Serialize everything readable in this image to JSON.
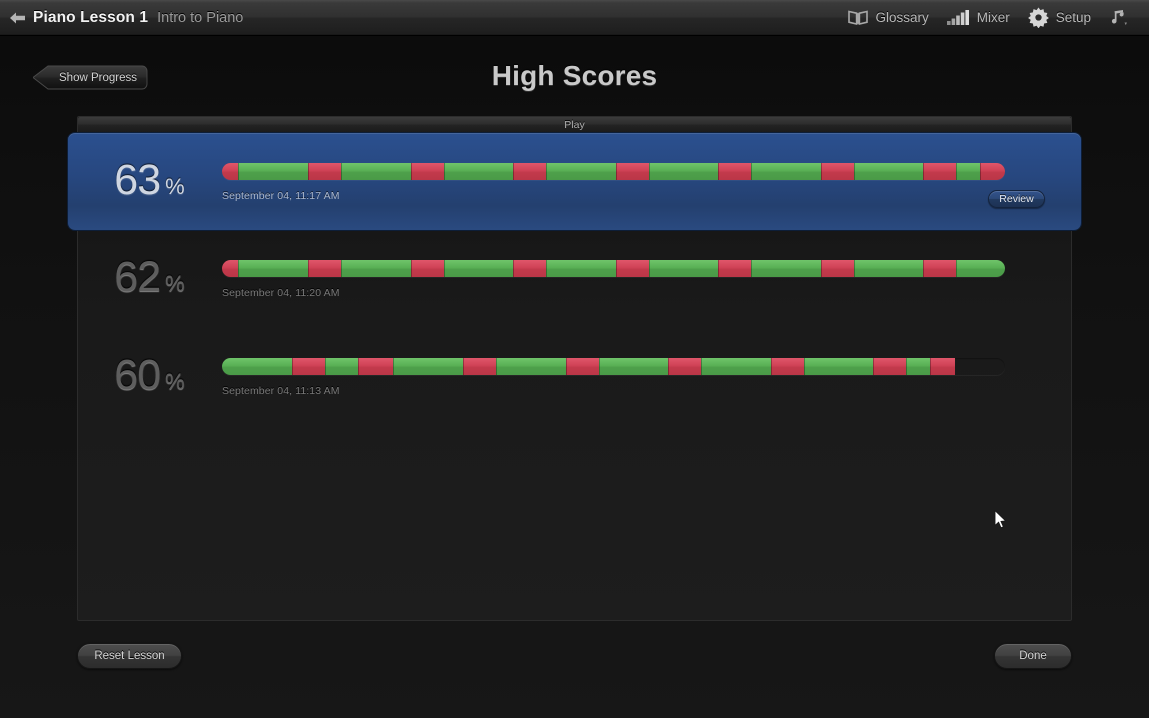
{
  "toolbar": {
    "back_icon": "back-arrow-icon",
    "title": "Piano Lesson 1",
    "subtitle": "Intro to Piano",
    "items": [
      {
        "icon": "book-icon",
        "label": "Glossary"
      },
      {
        "icon": "mixer-icon",
        "label": "Mixer"
      },
      {
        "icon": "gear-icon",
        "label": "Setup"
      },
      {
        "icon": "music-note-icon",
        "label": ""
      }
    ]
  },
  "header": {
    "show_progress_label": "Show Progress",
    "page_title": "High Scores"
  },
  "panel": {
    "section_label": "Play"
  },
  "scores": [
    {
      "percent": "63",
      "percent_sign": "%",
      "timestamp": "September 04, 11:17 AM",
      "selected": true,
      "review_label": "Review",
      "segments": [
        {
          "color": "r",
          "w": 2.1
        },
        {
          "color": "g",
          "w": 8.9
        },
        {
          "color": "r",
          "w": 4.2
        },
        {
          "color": "g",
          "w": 8.9
        },
        {
          "color": "r",
          "w": 4.2
        },
        {
          "color": "g",
          "w": 8.9
        },
        {
          "color": "r",
          "w": 4.2
        },
        {
          "color": "g",
          "w": 8.9
        },
        {
          "color": "r",
          "w": 4.2
        },
        {
          "color": "g",
          "w": 8.9
        },
        {
          "color": "r",
          "w": 4.2
        },
        {
          "color": "g",
          "w": 8.9
        },
        {
          "color": "r",
          "w": 4.2
        },
        {
          "color": "g",
          "w": 8.9
        },
        {
          "color": "r",
          "w": 4.2
        },
        {
          "color": "g",
          "w": 3.0
        },
        {
          "color": "r",
          "w": 3.2
        }
      ]
    },
    {
      "percent": "62",
      "percent_sign": "%",
      "timestamp": "September 04, 11:20 AM",
      "selected": false,
      "review_label": "",
      "segments": [
        {
          "color": "r",
          "w": 2.1
        },
        {
          "color": "g",
          "w": 8.9
        },
        {
          "color": "r",
          "w": 4.2
        },
        {
          "color": "g",
          "w": 8.9
        },
        {
          "color": "r",
          "w": 4.2
        },
        {
          "color": "g",
          "w": 8.9
        },
        {
          "color": "r",
          "w": 4.2
        },
        {
          "color": "g",
          "w": 8.9
        },
        {
          "color": "r",
          "w": 4.2
        },
        {
          "color": "g",
          "w": 8.9
        },
        {
          "color": "r",
          "w": 4.2
        },
        {
          "color": "g",
          "w": 8.9
        },
        {
          "color": "r",
          "w": 4.2
        },
        {
          "color": "g",
          "w": 8.9
        },
        {
          "color": "r",
          "w": 4.2
        },
        {
          "color": "g",
          "w": 6.2
        }
      ]
    },
    {
      "percent": "60",
      "percent_sign": "%",
      "timestamp": "September 04, 11:13 AM",
      "selected": false,
      "review_label": "",
      "segments": [
        {
          "color": "g",
          "w": 8.9
        },
        {
          "color": "r",
          "w": 4.2
        },
        {
          "color": "g",
          "w": 4.3
        },
        {
          "color": "r",
          "w": 4.5
        },
        {
          "color": "g",
          "w": 8.9
        },
        {
          "color": "r",
          "w": 4.2
        },
        {
          "color": "g",
          "w": 8.9
        },
        {
          "color": "r",
          "w": 4.2
        },
        {
          "color": "g",
          "w": 8.9
        },
        {
          "color": "r",
          "w": 4.2
        },
        {
          "color": "g",
          "w": 8.9
        },
        {
          "color": "r",
          "w": 4.2
        },
        {
          "color": "g",
          "w": 8.9
        },
        {
          "color": "r",
          "w": 4.2
        },
        {
          "color": "g",
          "w": 3.0
        },
        {
          "color": "r",
          "w": 3.2
        }
      ]
    }
  ],
  "footer": {
    "reset_label": "Reset Lesson",
    "done_label": "Done"
  },
  "colors": {
    "selected_row": "#27477f",
    "bar_green": "#59b055",
    "bar_red": "#cf4256",
    "accent_text": "#c9c9c9"
  }
}
